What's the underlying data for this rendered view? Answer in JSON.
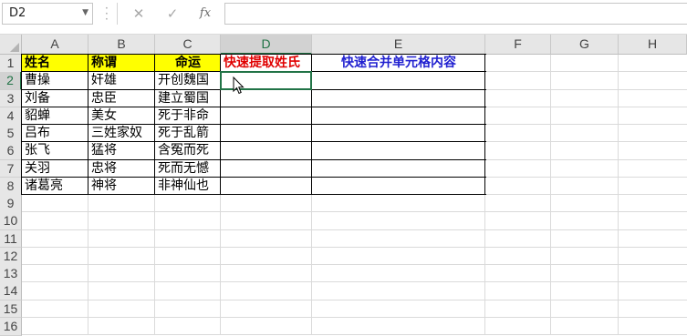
{
  "formula_bar": {
    "cell_reference": "D2",
    "cancel_glyph": "✕",
    "enter_glyph": "✓",
    "fx_label": "fx",
    "formula_value": ""
  },
  "grid": {
    "columns": [
      "A",
      "B",
      "C",
      "D",
      "E",
      "F",
      "G",
      "H"
    ],
    "rows": [
      "1",
      "2",
      "3",
      "4",
      "5",
      "6",
      "7",
      "8",
      "9",
      "10",
      "11",
      "12",
      "13",
      "14",
      "15",
      "16"
    ],
    "active_cell": "D2"
  },
  "table": {
    "headers": [
      "姓名",
      "称谓",
      "命运",
      "快速提取姓氏",
      "快速合并单元格内容"
    ],
    "rows": [
      [
        "曹操",
        "奸雄",
        "开创魏国",
        "",
        ""
      ],
      [
        "刘备",
        "忠臣",
        "建立蜀国",
        "",
        ""
      ],
      [
        "貂蝉",
        "美女",
        "死于非命",
        "",
        ""
      ],
      [
        "吕布",
        "三姓家奴",
        "死于乱箭",
        "",
        ""
      ],
      [
        "张飞",
        "猛将",
        "含冤而死",
        "",
        ""
      ],
      [
        "关羽",
        "忠将",
        "死而无憾",
        "",
        ""
      ],
      [
        "诸葛亮",
        "神将",
        "非神仙也",
        "",
        ""
      ]
    ]
  },
  "colors": {
    "header_fill": "#ffff00",
    "extract_header_color": "#e00000",
    "merge_header_color": "#2020d0",
    "selection_accent": "#217346"
  }
}
